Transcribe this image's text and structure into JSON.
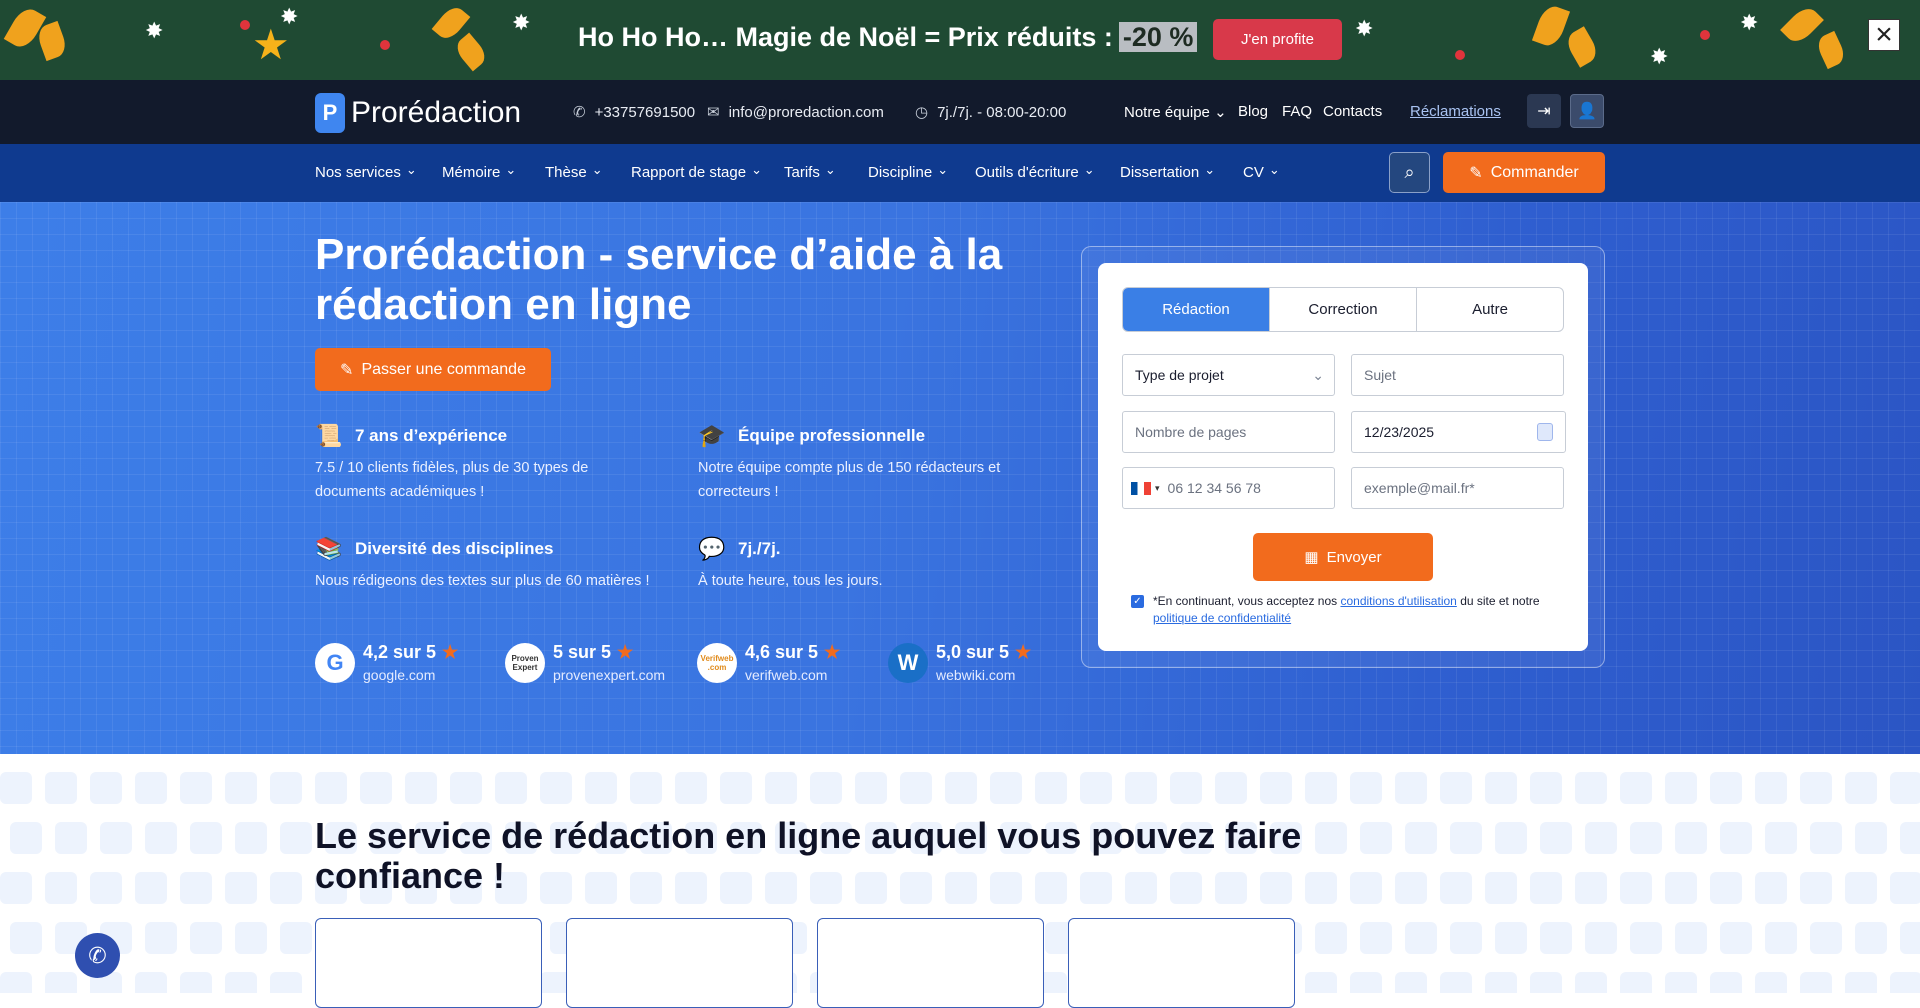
{
  "promo": {
    "text": "Ho Ho Ho… Magie de Noël = Prix réduits :",
    "discount": "-20 %",
    "cta": "J'en profite",
    "close_glyph": "×"
  },
  "topbar": {
    "brand": "Prorédaction",
    "phone": "+33757691500",
    "email": "info@proredaction.com",
    "hours": "7j./7j. - 08:00-20:00",
    "links": [
      "Notre équipe",
      "Blog",
      "FAQ",
      "Contacts"
    ],
    "reclamations": "Réclamations",
    "icons": {
      "phone": "phone-icon",
      "email": "mail-icon",
      "hours": "clock-icon",
      "login": "login-icon",
      "user": "user-icon"
    }
  },
  "nav": {
    "items": [
      "Nos services",
      "Mémoire",
      "Thèse",
      "Rapport de stage",
      "Tarifs",
      "Discipline",
      "Outils d'écriture",
      "Dissertation",
      "CV"
    ],
    "order": "Commander"
  },
  "hero": {
    "title": "Prorédaction - service d’aide à la rédaction en ligne",
    "cta": "Passer une commande",
    "features": [
      {
        "title": "7 ans d’expérience",
        "text": "7.5 / 10 clients fidèles, plus de 30 types de documents académiques !"
      },
      {
        "title": "Équipe professionnelle",
        "text": "Notre équipe compte plus de 150 rédacteurs et correcteurs !"
      },
      {
        "title": "Diversité des disciplines",
        "text": "Nous rédigeons des textes sur plus de 60 matières !"
      },
      {
        "title": "7j./7j.",
        "text": "À toute heure, tous les jours."
      }
    ],
    "ratings": [
      {
        "score": "4,2 sur 5",
        "site": "google.com",
        "badge": "G"
      },
      {
        "score": "5 sur 5",
        "site": "provenexpert.com",
        "badge": "Proven Expert"
      },
      {
        "score": "4,6 sur 5",
        "site": "verifweb.com",
        "badge": "Verifweb .com"
      },
      {
        "score": "5,0 sur 5",
        "site": "webwiki.com",
        "badge": "W"
      }
    ]
  },
  "form": {
    "tabs": [
      "Rédaction",
      "Correction",
      "Autre"
    ],
    "project_type": "Type de projet",
    "subject_placeholder": "Sujet",
    "pages_placeholder": "Nombre de pages",
    "date_value": "12/23/2025",
    "phone_placeholder": "06 12 34 56 78",
    "email_placeholder": "exemple@mail.fr*",
    "submit": "Envoyer",
    "consent_prefix": "*En continuant, vous acceptez nos",
    "terms_link": "conditions d'utilisation",
    "consent_mid": "du site et notre",
    "privacy_link": "politique de confidentialité"
  },
  "section": {
    "title": "Le service de rédaction en ligne auquel vous pouvez faire confiance !"
  }
}
